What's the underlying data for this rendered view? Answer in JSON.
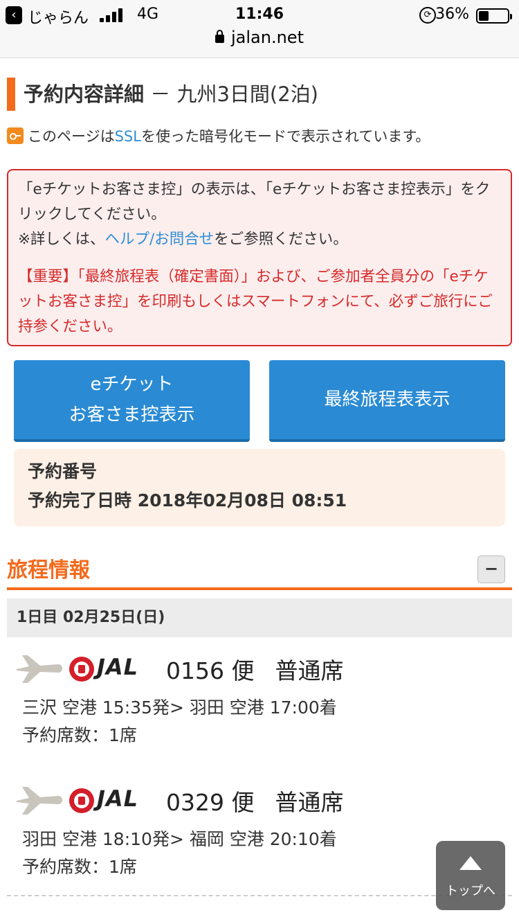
{
  "status_bar": {
    "app_name": "じゃらん",
    "network": "4G",
    "time": "11:46",
    "battery": "36%",
    "battery_level": 0.36
  },
  "browser": {
    "url": "jalan.net"
  },
  "page": {
    "title_main": "予約内容詳細",
    "title_sub": "－ 九州3日間(2泊)",
    "ssl_prefix": "このページは",
    "ssl_link": "SSL",
    "ssl_suffix": "を使った暗号化モードで表示されています。"
  },
  "notice": {
    "line1": "「eチケットお客さま控」の表示は、「eチケットお客さま控表示」をクリックしてください。",
    "help_prefix": "※詳しくは、",
    "help_link": "ヘルプ/お問合せ",
    "help_suffix": "をご参照ください。",
    "important": "【重要】「最終旅程表（確定書面）」および、ご参加者全員分の「eチケットお客さま控」を印刷もしくはスマートフォンにて、必ずご旅行にご持参ください。"
  },
  "buttons": {
    "ticket_line1": "eチケット",
    "ticket_line2": "お客さま控表示",
    "itinerary": "最終旅程表表示"
  },
  "reservation": {
    "number_label": "予約番号",
    "number_value": "",
    "date_label": "予約完了日時",
    "date_value": "2018年02月08日 08:51"
  },
  "itinerary": {
    "section_title": "旅程情報",
    "collapse_label": "−",
    "day_label": "1日目 02月25日(日)",
    "flights": [
      {
        "airline": "JAL",
        "flight_no": "0156 便",
        "seat_class": "普通席",
        "route": "三沢 空港 15:35発> 羽田 空港 17:00着",
        "seats": "予約席数：1席"
      },
      {
        "airline": "JAL",
        "flight_no": "0329 便",
        "seat_class": "普通席",
        "route": "羽田 空港 18:10発> 福岡 空港 20:10着",
        "seats": "予約席数：1席"
      }
    ]
  },
  "top_button": {
    "label": "トップへ"
  },
  "colors": {
    "accent": "#f26b1d",
    "button_blue": "#2a8ad4",
    "notice_red": "#d52a2a",
    "link_blue": "#2d8ed6"
  }
}
